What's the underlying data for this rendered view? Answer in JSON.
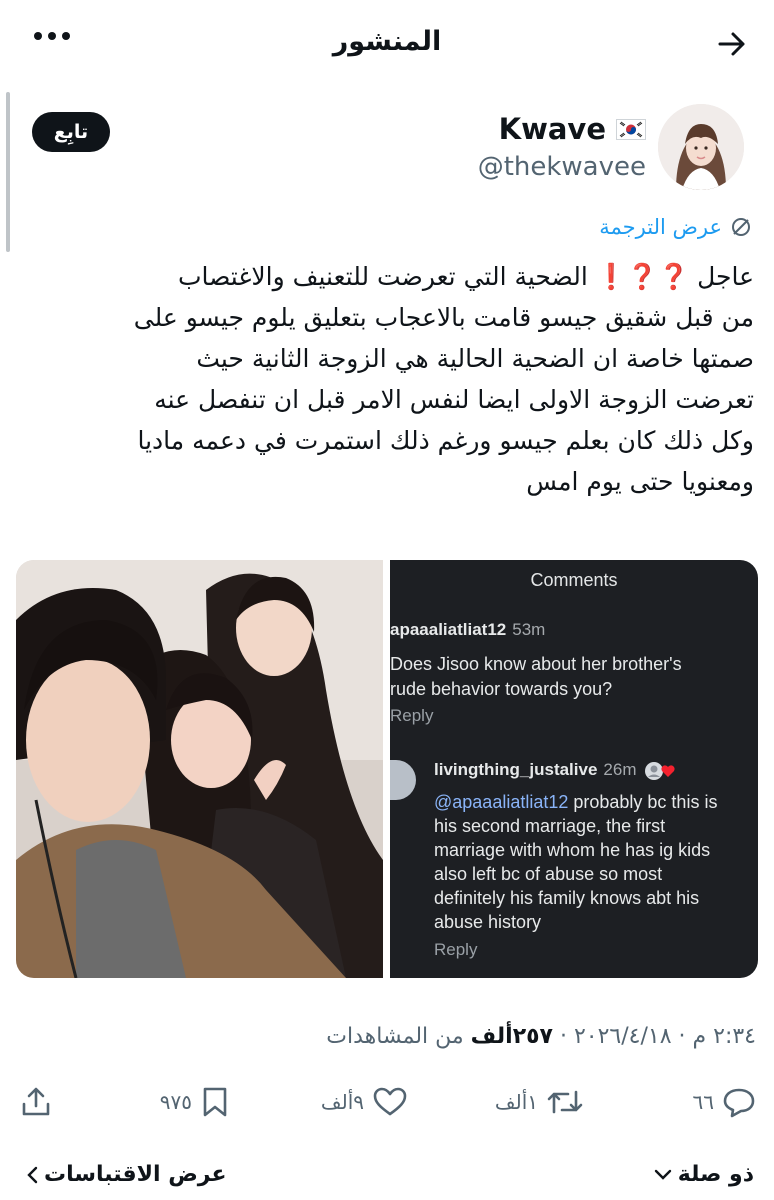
{
  "header": {
    "title": "المنشور"
  },
  "author": {
    "display_name": "Kwave",
    "flag": "south-korea-flag",
    "handle": "@thekwavee",
    "follow_label": "تابِع"
  },
  "translate": {
    "label": "عرض الترجمة"
  },
  "post": {
    "lines": [
      "عاجل ❓❓❗️ الضحية التي تعرضت للتعنيف والاغتصاب",
      "من قبل شقيق جيسو قامت بالاعجاب بتعليق يلوم جيسو على",
      "صمتها خاصة ان الضحية الحالية هي الزوجة الثانية حيث",
      "تعرضت الزوجة الاولى ايضا لنفس الامر قبل ان تنفصل عنه",
      "وكل ذلك كان بعلم جيسو ورغم ذلك استمرت في دعمه ماديا",
      "ومعنويا حتى يوم امس"
    ]
  },
  "media": {
    "screenshot": {
      "title": "Comments",
      "comment1": {
        "user": "apaaaliatliat12",
        "time": "53m",
        "lines": [
          "Does Jisoo know about her brother's",
          "rude behavior towards you?"
        ],
        "reply": "Reply"
      },
      "comment2": {
        "user": "livingthing_justalive",
        "time": "26m",
        "mention": "@apaaaliatliat12",
        "first_line_rest": " probably bc this is",
        "lines": [
          "his second marriage, the first",
          "marriage with whom he has ig kids",
          "also left bc of abuse so most",
          "definitely his family knows abt his",
          "abuse history"
        ],
        "reply": "Reply"
      }
    }
  },
  "meta": {
    "time": "٢:٣٤ م",
    "separator": " · ",
    "date": "٢٠٢٦/٤/١٨",
    "views": "٢٥٧ألف",
    "views_label": "من المشاهدات"
  },
  "actions": {
    "replies": "٦٦",
    "reposts": "١ألف",
    "likes": "٩ألف",
    "bookmarks": "٩٧٥"
  },
  "bottom": {
    "related": "ذو صلة",
    "quotes": "عرض الاقتباسات"
  },
  "colors": {
    "accent": "#1d9bf0",
    "text": "#0f1419",
    "muted": "#536471",
    "screenshot_bg": "#1d1f23"
  }
}
